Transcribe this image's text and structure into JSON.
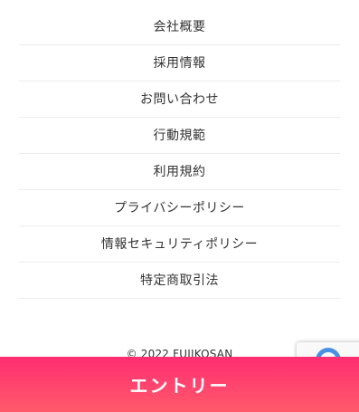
{
  "footer_nav": {
    "items": [
      {
        "label": "会社概要"
      },
      {
        "label": "採用情報"
      },
      {
        "label": "お問い合わせ"
      },
      {
        "label": "行動規範"
      },
      {
        "label": "利用規約"
      },
      {
        "label": "プライバシーポリシー"
      },
      {
        "label": "情報セキュリティポリシー"
      },
      {
        "label": "特定商取引法"
      }
    ]
  },
  "copyright": "© 2022 FUJIKOSAN",
  "recaptcha": {
    "icon": "recaptcha-icon"
  },
  "entry_button": {
    "label": "エントリー",
    "gradient_top": "#ff2d72",
    "gradient_bottom": "#ff5a6a"
  }
}
